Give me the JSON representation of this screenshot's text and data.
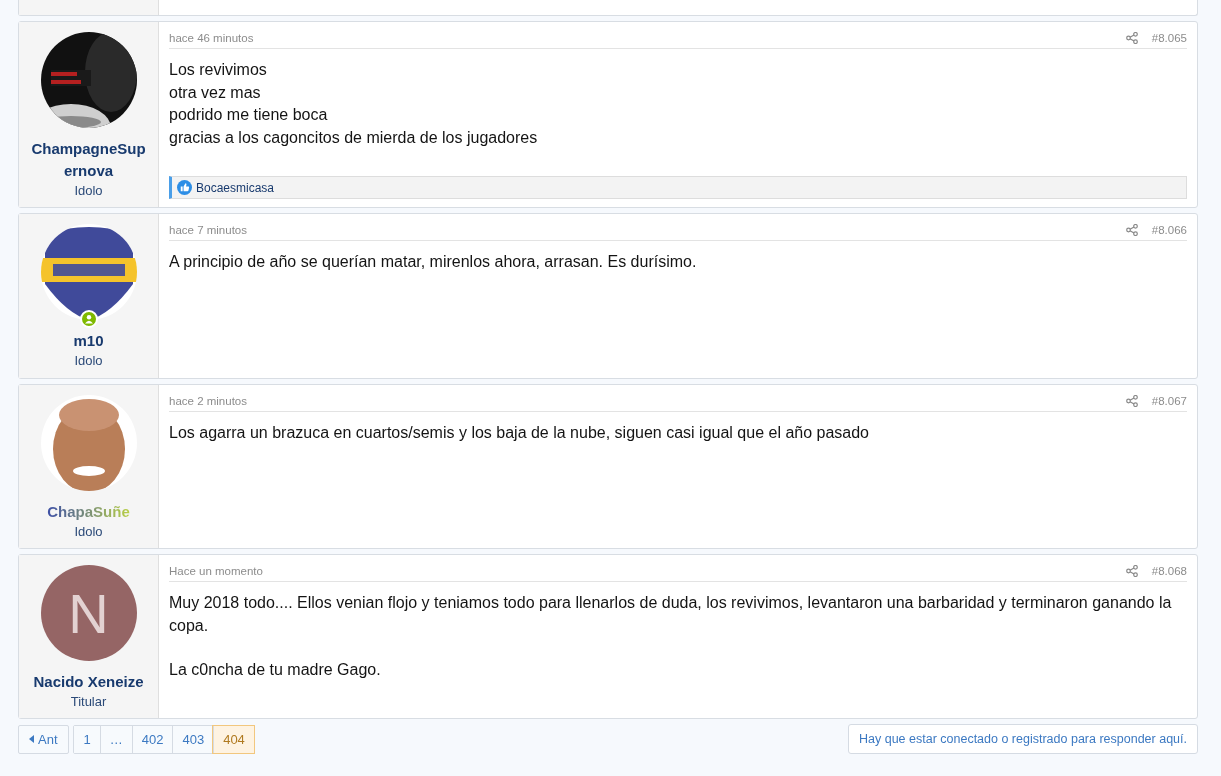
{
  "posts": [
    {
      "user": "ChampagneSup ernova",
      "gradient_name": false,
      "rank": "Idolo",
      "avatar": {
        "kind": "picture"
      },
      "online": false,
      "time": "hace 46 minutos",
      "number": "#8.065",
      "body": [
        "Los revivimos\notra vez mas\npodrido me tiene boca\ngracias a los cagoncitos de mierda de los jugadores"
      ],
      "reactions": "Bocaesmicasa"
    },
    {
      "user": "m10",
      "gradient_name": false,
      "rank": "Idolo",
      "avatar": {
        "kind": "picture"
      },
      "online": true,
      "time": "hace 7 minutos",
      "number": "#8.066",
      "body": [
        "A principio de año se querían matar, mirenlos ahora, arrasan. Es durísimo."
      ]
    },
    {
      "user": "ChapaSuñe",
      "gradient_name": true,
      "rank": "Idolo",
      "avatar": {
        "kind": "picture"
      },
      "online": false,
      "time": "hace 2 minutos",
      "number": "#8.067",
      "body": [
        "Los agarra un brazuca en cuartos/semis y los baja de la nube, siguen casi igual que el año pasado"
      ]
    },
    {
      "user": "Nacido Xeneize",
      "gradient_name": false,
      "rank": "Titular",
      "avatar": {
        "kind": "letter",
        "letter": "N",
        "color": "#956565"
      },
      "online": false,
      "time": "Hace un momento",
      "number": "#8.068",
      "body": [
        "Muy 2018 todo.... Ellos venian flojo y teniamos todo para llenarlos de duda, los revivimos, levantaron una barbaridad y terminaron ganando la copa.",
        "La c0ncha de tu madre Gago."
      ]
    }
  ],
  "pagination": {
    "prev": "Ant",
    "pages": [
      {
        "label": "1",
        "selected": false
      },
      {
        "label": "…",
        "selected": false
      },
      {
        "label": "402",
        "selected": false
      },
      {
        "label": "403",
        "selected": false
      },
      {
        "label": "404",
        "selected": true
      }
    ]
  },
  "reply_notice": "Hay que estar conectado o registrado para responder aquí."
}
